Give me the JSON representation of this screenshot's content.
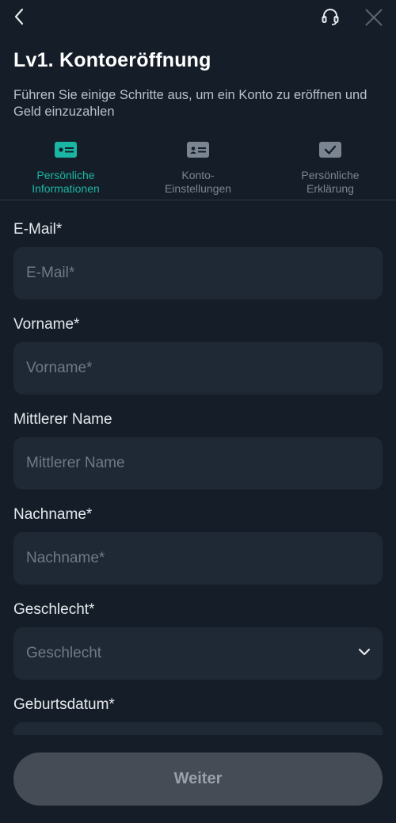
{
  "header": {
    "title": "Lv1. Kontoeröffnung",
    "subtitle": "Führen Sie einige Schritte aus, um ein Konto zu eröffnen und Geld einzuzahlen",
    "icons": {
      "back": "chevron-left-icon",
      "support": "headset-icon",
      "close": "close-icon"
    }
  },
  "steps": [
    {
      "label": "Persönliche Informationen",
      "icon": "id-card-icon",
      "active": true
    },
    {
      "label": "Konto-Einstellungen",
      "icon": "account-card-icon",
      "active": false
    },
    {
      "label": "Persönliche Erklärung",
      "icon": "checkbox-icon",
      "active": false
    }
  ],
  "form": {
    "email": {
      "label": "E-Mail*",
      "placeholder": "E-Mail*"
    },
    "firstname": {
      "label": "Vorname*",
      "placeholder": "Vorname*"
    },
    "middlename": {
      "label": "Mittlerer Name",
      "placeholder": "Mittlerer Name"
    },
    "lastname": {
      "label": "Nachname*",
      "placeholder": "Nachname*"
    },
    "gender": {
      "label": "Geschlecht*",
      "placeholder": "Geschlecht"
    },
    "birthdate": {
      "label": "Geburtsdatum*"
    }
  },
  "actions": {
    "continue": "Weiter"
  },
  "colors": {
    "background": "#151e28",
    "field": "#1f2935",
    "accent": "#1bb5a3",
    "button": "#454c56"
  }
}
